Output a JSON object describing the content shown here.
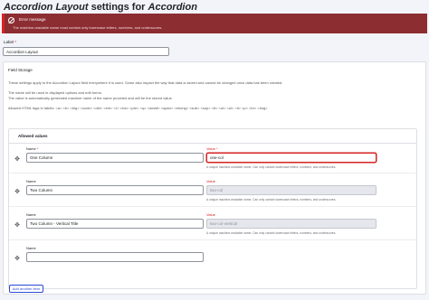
{
  "page": {
    "title_prefix": "Accordion Layout",
    "title_middle": " settings for ",
    "title_suffix": "Accordion"
  },
  "alert": {
    "title": "Error message",
    "message": "The machine-readable name must contain only lowercase letters, numbers, and underscores."
  },
  "label_field": {
    "label": "Label",
    "required_mark": "*",
    "value": "Accordion Layout"
  },
  "field_storage": {
    "title": "Field Storage",
    "info_1": "These settings apply to the Accordion Layout field everywhere it is used. Some also impact the way that data is stored and cannot be changed once data has been created.",
    "info_2": "The name will be used in displayed options and edit forms.",
    "info_3": "The value is automatically generated machine name of the name provided and will be the stored value.",
    "info_4": "Allowed HTML tags in labels: <a> <b> <big> <code> <del> <em> <i> <ins> <pre> <q> <small> <span> <strong> <sub> <sup> <tt> <ol> <ul> <li> <p> <br> <img>"
  },
  "allowed_values": {
    "title": "Allowed values",
    "name_label": "Name",
    "value_label": "Value",
    "required_mark": "*",
    "help": "A unique machine-readable name. Can only contain lowercase letters, numbers, and underscores.",
    "rows": [
      {
        "name": "One Column",
        "value": "one-col"
      },
      {
        "name": "Two Column",
        "value": "two-col"
      },
      {
        "name": "Two Column - Vertical Title",
        "value": "two-col-vertical"
      },
      {
        "name": "",
        "value": ""
      }
    ],
    "add_button": "Add another item"
  },
  "colors": {
    "error": "#d72222",
    "alert_bg": "#8c2d32",
    "button_blue": "#2b4ad7"
  }
}
